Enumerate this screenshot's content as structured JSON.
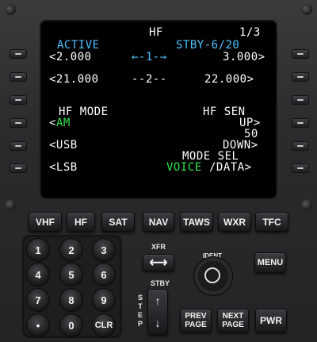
{
  "screen": {
    "title": "HF",
    "page": "1/3",
    "left": {
      "active_label": "ACTIVE",
      "freq1": "<2.000",
      "freq2": "<21.000",
      "mode_label": "HF MODE",
      "am": "AM",
      "am_arrow": "<",
      "usb": "<USB",
      "lsb": "<LSB"
    },
    "center": {
      "row1": "←-1-→",
      "row2": "--2--"
    },
    "right": {
      "stby_label": "STBY-6/20",
      "freq1": "3.000>",
      "freq2": "22.000>",
      "sen_label": "HF SEN",
      "up": "UP>",
      "value": "50",
      "down": "DOWN>",
      "mode_sel": "MODE SEL",
      "voice": "VOICE",
      "data": "/DATA>"
    }
  },
  "function_keys": [
    "VHF",
    "HF",
    "SAT",
    "NAV",
    "TAWS",
    "WXR",
    "TFC"
  ],
  "numpad": [
    "1",
    "2",
    "3",
    "4",
    "5",
    "6",
    "7",
    "8",
    "9",
    "•",
    "0",
    "CLR"
  ],
  "controls": {
    "xfr": "XFR",
    "xfr_arrow": "⟷",
    "stby": "STBY",
    "step": "STEP",
    "up_arrow": "↑",
    "down_arrow": "↓",
    "ident": "IDENT",
    "menu": "MENU",
    "prev_page": "PREV\nPAGE",
    "next_page": "NEXT\nPAGE",
    "pwr": "PWR"
  },
  "colors": {
    "white": "#ffffff",
    "cyan": "#4fc3ff",
    "green": "#31e34b"
  }
}
